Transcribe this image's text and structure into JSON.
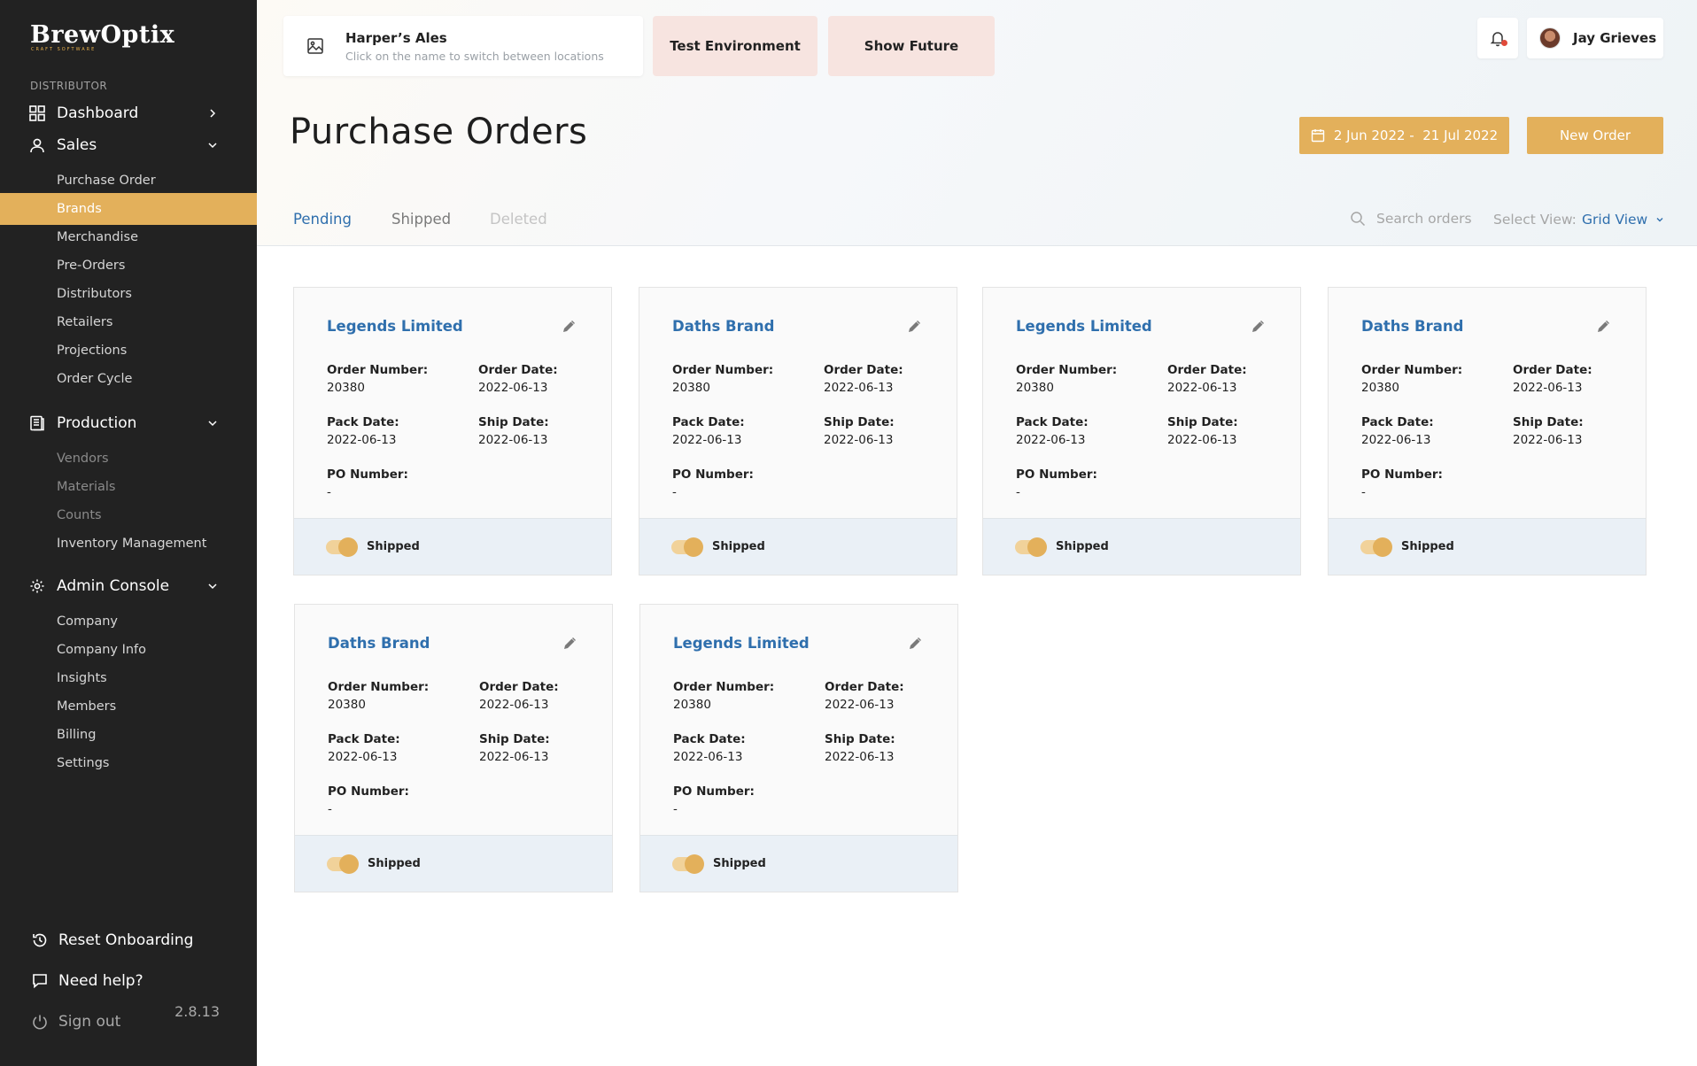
{
  "brand": {
    "name": "BrewOptix",
    "tagline": "CRAFT SOFTWARE"
  },
  "sidebar": {
    "section_label": "DISTRIBUTOR",
    "dashboard": "Dashboard",
    "sales": "Sales",
    "sales_items": [
      "Purchase Order",
      "Brands",
      "Merchandise",
      "Pre-Orders",
      "Distributors",
      "Retailers",
      "Projections",
      "Order Cycle"
    ],
    "production": "Production",
    "production_items": [
      "Vendors",
      "Materials",
      "Counts",
      "Inventory Management"
    ],
    "admin": "Admin Console",
    "admin_items": [
      "Company",
      "Company Info",
      "Insights",
      "Members",
      "Billing",
      "Settings"
    ],
    "reset": "Reset Onboarding",
    "help": "Need help?",
    "signout": "Sign out",
    "version": "2.8.13"
  },
  "header": {
    "location_name": "Harper’s Ales",
    "location_hint": "Click on the name to switch between locations",
    "test_env": "Test Environment",
    "show_future": "Show Future",
    "user_name": "Jay Grieves",
    "page_title": "Purchase Orders",
    "date_range": "2 Jun 2022 -  21 Jul 2022",
    "new_order": "New Order"
  },
  "tabs": [
    "Pending",
    "Shipped",
    "Deleted"
  ],
  "search": {
    "placeholder": "Search orders"
  },
  "view": {
    "label": "Select View:",
    "value": "Grid View"
  },
  "labels": {
    "order_number": "Order Number:",
    "order_date": "Order Date:",
    "pack_date": "Pack Date:",
    "ship_date": "Ship Date:",
    "po_number": "PO Number:",
    "status": "Shipped"
  },
  "orders": [
    {
      "brand": "Legends Limited",
      "order_number": "20380",
      "order_date": "2022-06-13",
      "pack_date": "2022-06-13",
      "ship_date": "2022-06-13",
      "po_number": "-"
    },
    {
      "brand": "Daths Brand",
      "order_number": "20380",
      "order_date": "2022-06-13",
      "pack_date": "2022-06-13",
      "ship_date": "2022-06-13",
      "po_number": "-"
    },
    {
      "brand": "Legends Limited",
      "order_number": "20380",
      "order_date": "2022-06-13",
      "pack_date": "2022-06-13",
      "ship_date": "2022-06-13",
      "po_number": "-"
    },
    {
      "brand": "Daths Brand",
      "order_number": "20380",
      "order_date": "2022-06-13",
      "pack_date": "2022-06-13",
      "ship_date": "2022-06-13",
      "po_number": "-"
    },
    {
      "brand": "Daths Brand",
      "order_number": "20380",
      "order_date": "2022-06-13",
      "pack_date": "2022-06-13",
      "ship_date": "2022-06-13",
      "po_number": "-"
    },
    {
      "brand": "Legends Limited",
      "order_number": "20380",
      "order_date": "2022-06-13",
      "pack_date": "2022-06-13",
      "ship_date": "2022-06-13",
      "po_number": "-"
    }
  ]
}
